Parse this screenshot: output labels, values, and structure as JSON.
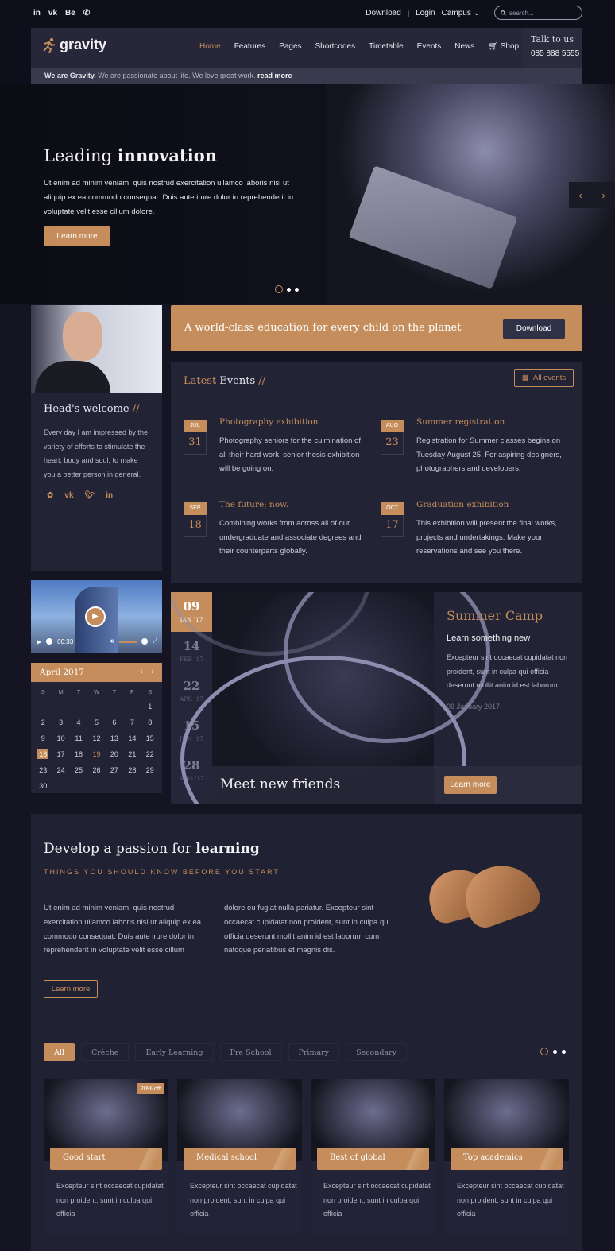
{
  "topbar": {
    "social": [
      "in",
      "vk",
      "Bē",
      "✆"
    ],
    "links": {
      "download": "Download",
      "sep": "|",
      "login": "Login",
      "campus": "Campus ⌄"
    },
    "search_placeholder": "search..."
  },
  "nav": {
    "logo": "gravity",
    "items": [
      "Home",
      "Features",
      "Pages",
      "Shortcodes",
      "Timetable",
      "Events",
      "News",
      "Shop"
    ],
    "talk_label": "Talk to us",
    "phone": "085 888 5555"
  },
  "tagline": {
    "bold": "We are Gravity.",
    "text": " We are passionate about life. We love great work. ",
    "link": "read more"
  },
  "hero": {
    "title_light": "Leading ",
    "title_bold": "innovation",
    "body": "Ut enim ad minim veniam, quis nostrud exercitation ullamco laboris nisi ut aliquip ex ea commodo consequat. Duis aute irure dolor in reprehenderit in voluptate velit esse cillum dolore.",
    "cta": "Learn more",
    "slide_current": 1,
    "slide_count": 3
  },
  "head": {
    "title": "Head's welcome",
    "slashes": "//",
    "body": "Every day I am impressed by the variety of efforts to stimulate the heart, body and soul, to make you a better person in general.",
    "social": [
      "✿",
      "vk",
      "🐦",
      "in"
    ]
  },
  "banner": {
    "text": "A world-class education for every child on the planet",
    "button": "Download"
  },
  "events": {
    "title_accent": "Latest ",
    "title": "Events",
    "slashes": "//",
    "all_button": "All events",
    "items": [
      {
        "month": "JUL",
        "day": "31",
        "title": "Photography exhibition",
        "desc": "Photography seniors for the culmination of all their hard work. senior thesis exhibition will be going on."
      },
      {
        "month": "AUG",
        "day": "23",
        "title": "Summer registration",
        "desc": "Registration for Summer classes begins on Tuesday August 25. For aspiring designers, photographers and developers."
      },
      {
        "month": "SEP",
        "day": "18",
        "title": "The future; now.",
        "desc": "Combining works from across all of our undergraduate and associate degrees and their counterparts globally."
      },
      {
        "month": "OCT",
        "day": "17",
        "title": "Graduation exhibition",
        "desc": "This exhibition will present the final works, projects and undertakings. Make your reservations and see you there."
      }
    ]
  },
  "video": {
    "time": "00:33"
  },
  "calendar": {
    "month": "April 2017",
    "weekdays": [
      "S",
      "M",
      "T",
      "W",
      "T",
      "F",
      "S"
    ],
    "days": [
      "",
      "",
      "",
      "",
      "",
      "",
      "1",
      "2",
      "3",
      "4",
      "5",
      "6",
      "7",
      "8",
      "9",
      "10",
      "11",
      "12",
      "13",
      "14",
      "15",
      "16",
      "17",
      "18",
      "19",
      "20",
      "21",
      "22",
      "23",
      "24",
      "25",
      "26",
      "27",
      "28",
      "29",
      "30"
    ],
    "today": "16",
    "highlight": "19"
  },
  "timeline": [
    {
      "day": "09",
      "sub": "JAN '17",
      "active": true
    },
    {
      "day": "14",
      "sub": "FEB '17"
    },
    {
      "day": "22",
      "sub": "APR '17"
    },
    {
      "day": "15",
      "sub": "JUN '17"
    },
    {
      "day": "28",
      "sub": "AUG '17"
    }
  ],
  "feature": {
    "caption": "Meet new friends",
    "title": "Summer Camp",
    "subtitle": "Learn something new",
    "body": "Excepteur sint occaecat cupidatat non proident, sunt in culpa qui officia deserunt mollit anim id est laborum.",
    "date": "09 January 2017",
    "cta": "Learn more"
  },
  "passion": {
    "title_light": "Develop a passion for ",
    "title_bold": "learning",
    "subtitle": "THINGS YOU SHOULD KNOW BEFORE YOU START",
    "col1": "Ut enim ad minim veniam, quis nostrud exercitation ullamco laboris nisi ut aliquip ex ea commodo consequat. Duis aute irure dolor in reprehenderit in voluptate velit esse cillum",
    "col2": "dolore eu fugiat nulla pariatur. Excepteur sint occaecat cupidatat non proident, sunt in culpa qui officia deserunt mollit anim id est laborum cum natoque penatibus et magnis dis.",
    "cta": "Learn more",
    "filters": [
      "All",
      "Crèche",
      "Early Learning",
      "Pre School",
      "Primary",
      "Secondary"
    ],
    "cards": [
      {
        "label": "Good start",
        "badge": "20% off",
        "text": "Excepteur sint occaecat cupidatat non proident, sunt in culpa qui officia"
      },
      {
        "label": "Medical school",
        "text": "Excepteur sint occaecat cupidatat non proident, sunt in culpa qui officia"
      },
      {
        "label": "Best of global",
        "text": "Excepteur sint occaecat cupidatat non proident, sunt in culpa qui officia"
      },
      {
        "label": "Top academics",
        "text": "Excepteur sint occaecat cupidatat non proident, sunt in culpa qui officia"
      }
    ]
  },
  "colors": {
    "accent": "#c48d5b",
    "panel": "#232336",
    "background": "#0f0f1c"
  }
}
